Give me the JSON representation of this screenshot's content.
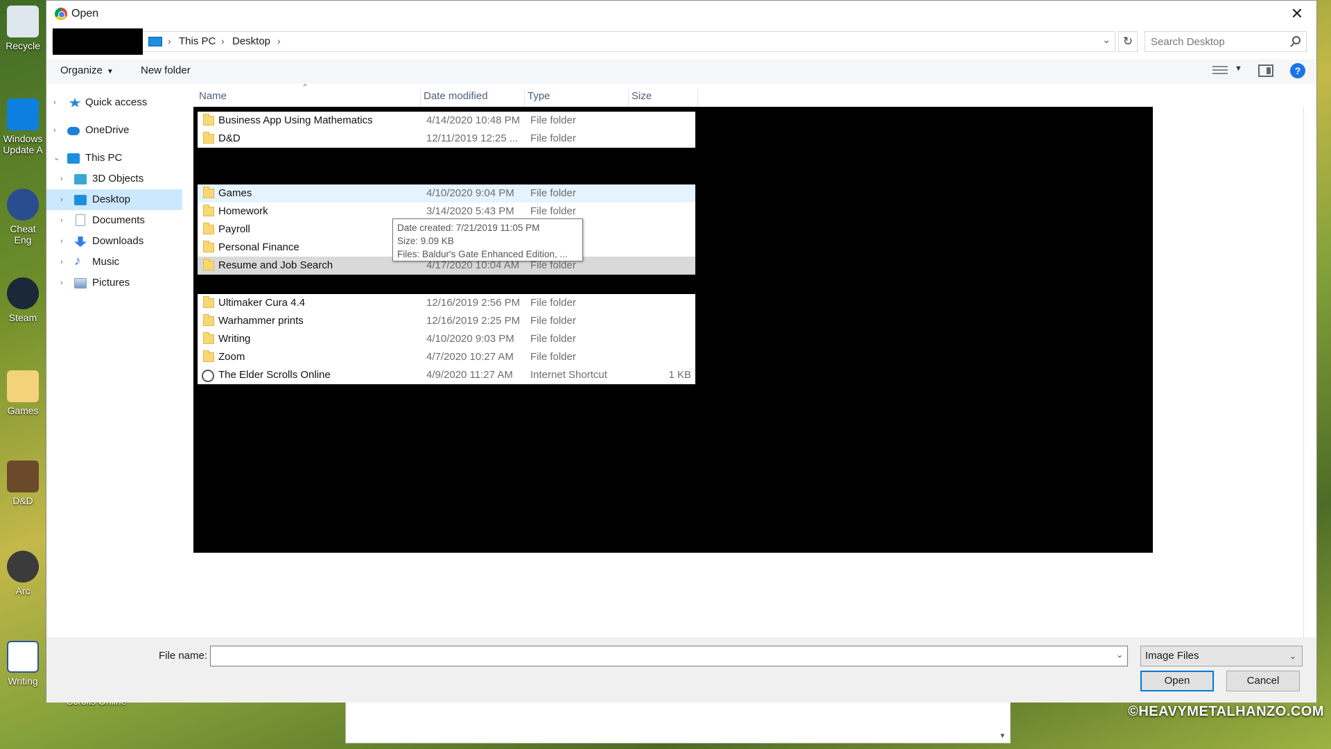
{
  "window": {
    "title": "Open"
  },
  "desktop": {
    "icons": [
      {
        "label": "Recycle",
        "icon": "recycle-bin-icon"
      },
      {
        "label": "Windows\nUpdate A",
        "icon": "windows-logo-icon"
      },
      {
        "label": "Cheat Eng",
        "icon": "gear-icon"
      },
      {
        "label": "Steam",
        "icon": "steam-icon"
      },
      {
        "label": "Games",
        "icon": "folder-icon"
      },
      {
        "label": "D&D",
        "icon": "folder-icon"
      },
      {
        "label": "Arc",
        "icon": "arc-icon"
      },
      {
        "label": "Writing",
        "icon": "document-icon"
      }
    ],
    "behind_label": "Scrolls Online",
    "watermark": "©HEAVYMETALHANZO.COM"
  },
  "address": {
    "crumbs": [
      "This PC",
      "Desktop"
    ],
    "search_placeholder": "Search Desktop"
  },
  "toolbar": {
    "organize": "Organize",
    "new_folder": "New folder"
  },
  "nav": {
    "items": [
      {
        "label": "Quick access",
        "color": "#2b87d6",
        "level": 0,
        "expander": "›"
      },
      {
        "label": "OneDrive",
        "color": "#1f7fd6",
        "level": 0,
        "expander": "›"
      },
      {
        "label": "This PC",
        "color": "#1b8fe0",
        "level": 0,
        "expander": "⌄"
      },
      {
        "label": "3D Objects",
        "color": "#3aa7d8",
        "level": 1,
        "expander": "›"
      },
      {
        "label": "Desktop",
        "color": "#1b8fe0",
        "level": 1,
        "expander": "›",
        "selected": true
      },
      {
        "label": "Documents",
        "color": "#8fa3b8",
        "level": 1,
        "expander": "›"
      },
      {
        "label": "Downloads",
        "color": "#2f80ed",
        "level": 1,
        "expander": "›"
      },
      {
        "label": "Music",
        "color": "#2f80ed",
        "level": 1,
        "expander": "›"
      },
      {
        "label": "Pictures",
        "color": "#7a9bbf",
        "level": 1,
        "expander": "›"
      }
    ]
  },
  "columns": {
    "name": "Name",
    "date": "Date modified",
    "type": "Type",
    "size": "Size"
  },
  "files": [
    {
      "name": "Business App Using Mathematics",
      "date": "4/14/2020 10:48 PM",
      "type": "File folder",
      "size": "",
      "icon": "folder"
    },
    {
      "name": "D&D",
      "date": "12/11/2019 12:25 ...",
      "type": "File folder",
      "size": "",
      "icon": "folder"
    },
    {
      "name": "Games",
      "date": "4/10/2020 9:04 PM",
      "type": "File folder",
      "size": "",
      "icon": "folder",
      "state": "hover"
    },
    {
      "name": "Homework",
      "date": "3/14/2020 5:43 PM",
      "type": "File folder",
      "size": "",
      "icon": "folder"
    },
    {
      "name": "Payroll",
      "date": "",
      "type": "",
      "size": "",
      "icon": "folder"
    },
    {
      "name": "Personal Finance",
      "date": "",
      "type": "",
      "size": "",
      "icon": "folder"
    },
    {
      "name": "Resume and Job Search",
      "date": "4/17/2020 10:04 AM",
      "type": "File folder",
      "size": "",
      "icon": "folder",
      "state": "selected"
    },
    {
      "name": "Ultimaker Cura 4.4",
      "date": "12/16/2019 2:56 PM",
      "type": "File folder",
      "size": "",
      "icon": "folder"
    },
    {
      "name": "Warhammer prints",
      "date": "12/16/2019 2:25 PM",
      "type": "File folder",
      "size": "",
      "icon": "folder"
    },
    {
      "name": "Writing",
      "date": "4/10/2020 9:03 PM",
      "type": "File folder",
      "size": "",
      "icon": "folder"
    },
    {
      "name": "Zoom",
      "date": "4/7/2020 10:27 AM",
      "type": "File folder",
      "size": "",
      "icon": "folder"
    },
    {
      "name": "The Elder Scrolls Online",
      "date": "4/9/2020 11:27 AM",
      "type": "Internet Shortcut",
      "size": "1 KB",
      "icon": "shortcut"
    }
  ],
  "tooltip": {
    "created": "Date created: 7/21/2019 11:05 PM",
    "size": "Size: 9.09 KB",
    "files": "Files: Baldur's Gate Enhanced Edition, ..."
  },
  "footer": {
    "file_name_label": "File name:",
    "file_name_value": "",
    "file_type": "Image Files",
    "open": "Open",
    "cancel": "Cancel"
  },
  "colors": {
    "accent": "#0078d7",
    "selection": "#cce8ff",
    "hover": "#e5f3ff"
  }
}
